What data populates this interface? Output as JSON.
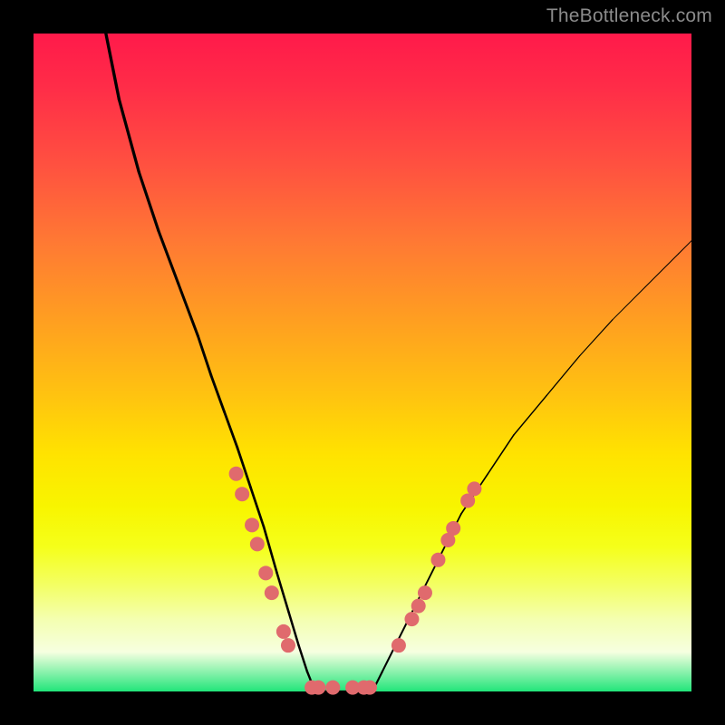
{
  "watermark": "TheBottleneck.com",
  "chart_data": {
    "type": "line",
    "title": "",
    "xlabel": "",
    "ylabel": "",
    "xlim": [
      0,
      100
    ],
    "ylim": [
      0,
      100
    ],
    "grid": false,
    "legend": false,
    "series": [
      {
        "name": "curve-left",
        "x": [
          11,
          13,
          16,
          19,
          22,
          25,
          27,
          29,
          31,
          33,
          35,
          37,
          38.8,
          40.3,
          41.6,
          42.8
        ],
        "y": [
          100,
          90,
          79,
          70,
          62,
          54,
          48,
          42.5,
          37,
          31,
          25,
          18,
          12,
          7,
          3,
          0
        ]
      },
      {
        "name": "valley-floor",
        "x": [
          42.8,
          45.5,
          49,
          51.5
        ],
        "y": [
          0,
          0,
          0,
          0
        ]
      },
      {
        "name": "curve-right",
        "x": [
          51.5,
          53,
          55,
          57,
          59.5,
          62,
          65,
          69,
          73,
          78,
          83,
          88,
          93,
          98,
          100
        ],
        "y": [
          0,
          3,
          7,
          11,
          16,
          21,
          27,
          33,
          39,
          45,
          51,
          56.5,
          61.5,
          66.5,
          68.5
        ]
      }
    ],
    "markers": [
      {
        "name": "dots",
        "points": [
          {
            "x": 30.8,
            "y": 33.1
          },
          {
            "x": 31.7,
            "y": 30.0
          },
          {
            "x": 33.2,
            "y": 25.3
          },
          {
            "x": 34.0,
            "y": 22.4
          },
          {
            "x": 35.3,
            "y": 18.0
          },
          {
            "x": 36.2,
            "y": 15.0
          },
          {
            "x": 38.0,
            "y": 9.1
          },
          {
            "x": 38.7,
            "y": 7.0
          },
          {
            "x": 42.3,
            "y": 0.6
          },
          {
            "x": 43.3,
            "y": 0.6
          },
          {
            "x": 45.5,
            "y": 0.6
          },
          {
            "x": 48.5,
            "y": 0.6
          },
          {
            "x": 50.2,
            "y": 0.6
          },
          {
            "x": 51.1,
            "y": 0.6
          },
          {
            "x": 55.5,
            "y": 7.0
          },
          {
            "x": 57.5,
            "y": 11.0
          },
          {
            "x": 58.5,
            "y": 13.0
          },
          {
            "x": 59.5,
            "y": 15.0
          },
          {
            "x": 61.5,
            "y": 20.0
          },
          {
            "x": 63.0,
            "y": 23.0
          },
          {
            "x": 63.8,
            "y": 24.8
          },
          {
            "x": 66.0,
            "y": 29.0
          },
          {
            "x": 67.0,
            "y": 30.8
          }
        ]
      }
    ],
    "gradient": {
      "type": "vertical",
      "stops": [
        {
          "pos": 0,
          "color": "#ff1a4a"
        },
        {
          "pos": 20,
          "color": "#ff5140"
        },
        {
          "pos": 44,
          "color": "#ffa020"
        },
        {
          "pos": 64,
          "color": "#ffe300"
        },
        {
          "pos": 84,
          "color": "#f3ff66"
        },
        {
          "pos": 100,
          "color": "#22e57a"
        }
      ]
    }
  }
}
